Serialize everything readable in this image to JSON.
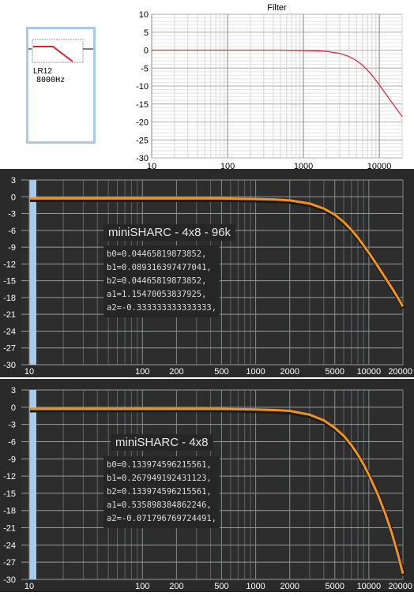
{
  "filter_block": {
    "type": "LR12",
    "frequency": "8000Hz"
  },
  "colors": {
    "filter_curve": "#e8202a",
    "dsp_curve": "#f0941e",
    "dsp_background": "#2a2a2a",
    "dsp_highlight_column": "#a9cbeb"
  },
  "chart_data": [
    {
      "type": "line",
      "title": "Filter",
      "xscale": "log",
      "xlim": [
        10,
        20000
      ],
      "ylim": [
        -30,
        10
      ],
      "xticks": [
        10,
        100,
        1000,
        10000
      ],
      "xtick_labels": [
        "10",
        "100",
        "1000",
        "10000"
      ],
      "yticks": [
        10,
        5,
        0,
        -5,
        -10,
        -15,
        -20,
        -25,
        -30
      ],
      "ytick_labels": [
        "10",
        "5",
        "0",
        "-5",
        "-10",
        "-15",
        "-20",
        "-25",
        "-30"
      ],
      "grid": true,
      "series": [
        {
          "x": [
            10,
            100,
            500,
            1000,
            1500,
            2000,
            3000,
            4000,
            5000,
            6000,
            7000,
            8000,
            9000,
            10000,
            12000,
            14000,
            16000,
            18000,
            20000
          ],
          "y": [
            0,
            0,
            0,
            -0.1,
            -0.2,
            -0.35,
            -0.9,
            -1.8,
            -2.9,
            -4.2,
            -5.6,
            -7.0,
            -8.4,
            -9.7,
            -12.0,
            -14.0,
            -15.7,
            -17.2,
            -18.5
          ]
        }
      ]
    },
    {
      "type": "line",
      "xscale": "log",
      "xlim": [
        10,
        20000
      ],
      "ylim": [
        -30,
        3
      ],
      "xtick_labels": [
        "10",
        "100",
        "200",
        "500",
        "1000",
        "2000",
        "5000",
        "10000",
        "20000"
      ],
      "xticks": [
        10,
        100,
        200,
        500,
        1000,
        2000,
        5000,
        10000,
        20000
      ],
      "ytick_labels": [
        "3",
        "0",
        "-3",
        "-6",
        "-9",
        "-12",
        "-15",
        "-18",
        "-21",
        "-24",
        "-27",
        "-30"
      ],
      "yticks": [
        3,
        0,
        -3,
        -6,
        -9,
        -12,
        -15,
        -18,
        -21,
        -24,
        -27,
        -30
      ],
      "grid": true,
      "annotations": {
        "title": "miniSHARC - 4x8 - 96k",
        "coefficients": [
          "b0=0.04465819873852,",
          "b1=0.089316397477041,",
          "b2=0.04465819873852,",
          "a1=1.15470053837925,",
          "a2=-0.333333333333333,"
        ]
      },
      "series": [
        {
          "x": [
            10,
            100,
            500,
            1000,
            1500,
            2000,
            3000,
            4000,
            5000,
            6000,
            7000,
            8000,
            9000,
            10000,
            12000,
            14000,
            16000,
            18000,
            20000
          ],
          "y": [
            -0.3,
            -0.3,
            -0.3,
            -0.4,
            -0.5,
            -0.65,
            -1.2,
            -2.1,
            -3.2,
            -4.5,
            -5.9,
            -7.3,
            -8.7,
            -10.0,
            -12.4,
            -14.5,
            -16.3,
            -18.0,
            -19.6
          ]
        }
      ]
    },
    {
      "type": "line",
      "xscale": "log",
      "xlim": [
        10,
        20000
      ],
      "ylim": [
        -30,
        3
      ],
      "xtick_labels": [
        "10",
        "100",
        "200",
        "500",
        "1000",
        "2000",
        "5000",
        "10000",
        "20000"
      ],
      "xticks": [
        10,
        100,
        200,
        500,
        1000,
        2000,
        5000,
        10000,
        20000
      ],
      "ytick_labels": [
        "3",
        "0",
        "-3",
        "-6",
        "-9",
        "-12",
        "-15",
        "-18",
        "-21",
        "-24",
        "-27",
        "-30"
      ],
      "yticks": [
        3,
        0,
        -3,
        -6,
        -9,
        -12,
        -15,
        -18,
        -21,
        -24,
        -27,
        -30
      ],
      "grid": true,
      "annotations": {
        "title": "miniSHARC - 4x8",
        "coefficients": [
          "b0=0.133974596215561,",
          "b1=0.267949192431123,",
          "b2=0.133974596215561,",
          "a1=0.535898384862246,",
          "a2=-0.071796769724491,"
        ]
      },
      "series": [
        {
          "x": [
            10,
            100,
            500,
            1000,
            1500,
            2000,
            3000,
            4000,
            5000,
            6000,
            7000,
            8000,
            9000,
            10000,
            12000,
            14000,
            16000,
            18000,
            19000,
            20000
          ],
          "y": [
            -0.3,
            -0.3,
            -0.3,
            -0.4,
            -0.5,
            -0.65,
            -1.3,
            -2.3,
            -3.6,
            -5.0,
            -6.6,
            -8.3,
            -10.0,
            -11.8,
            -15.2,
            -18.6,
            -22.0,
            -25.5,
            -27.3,
            -29.0
          ]
        }
      ]
    }
  ]
}
